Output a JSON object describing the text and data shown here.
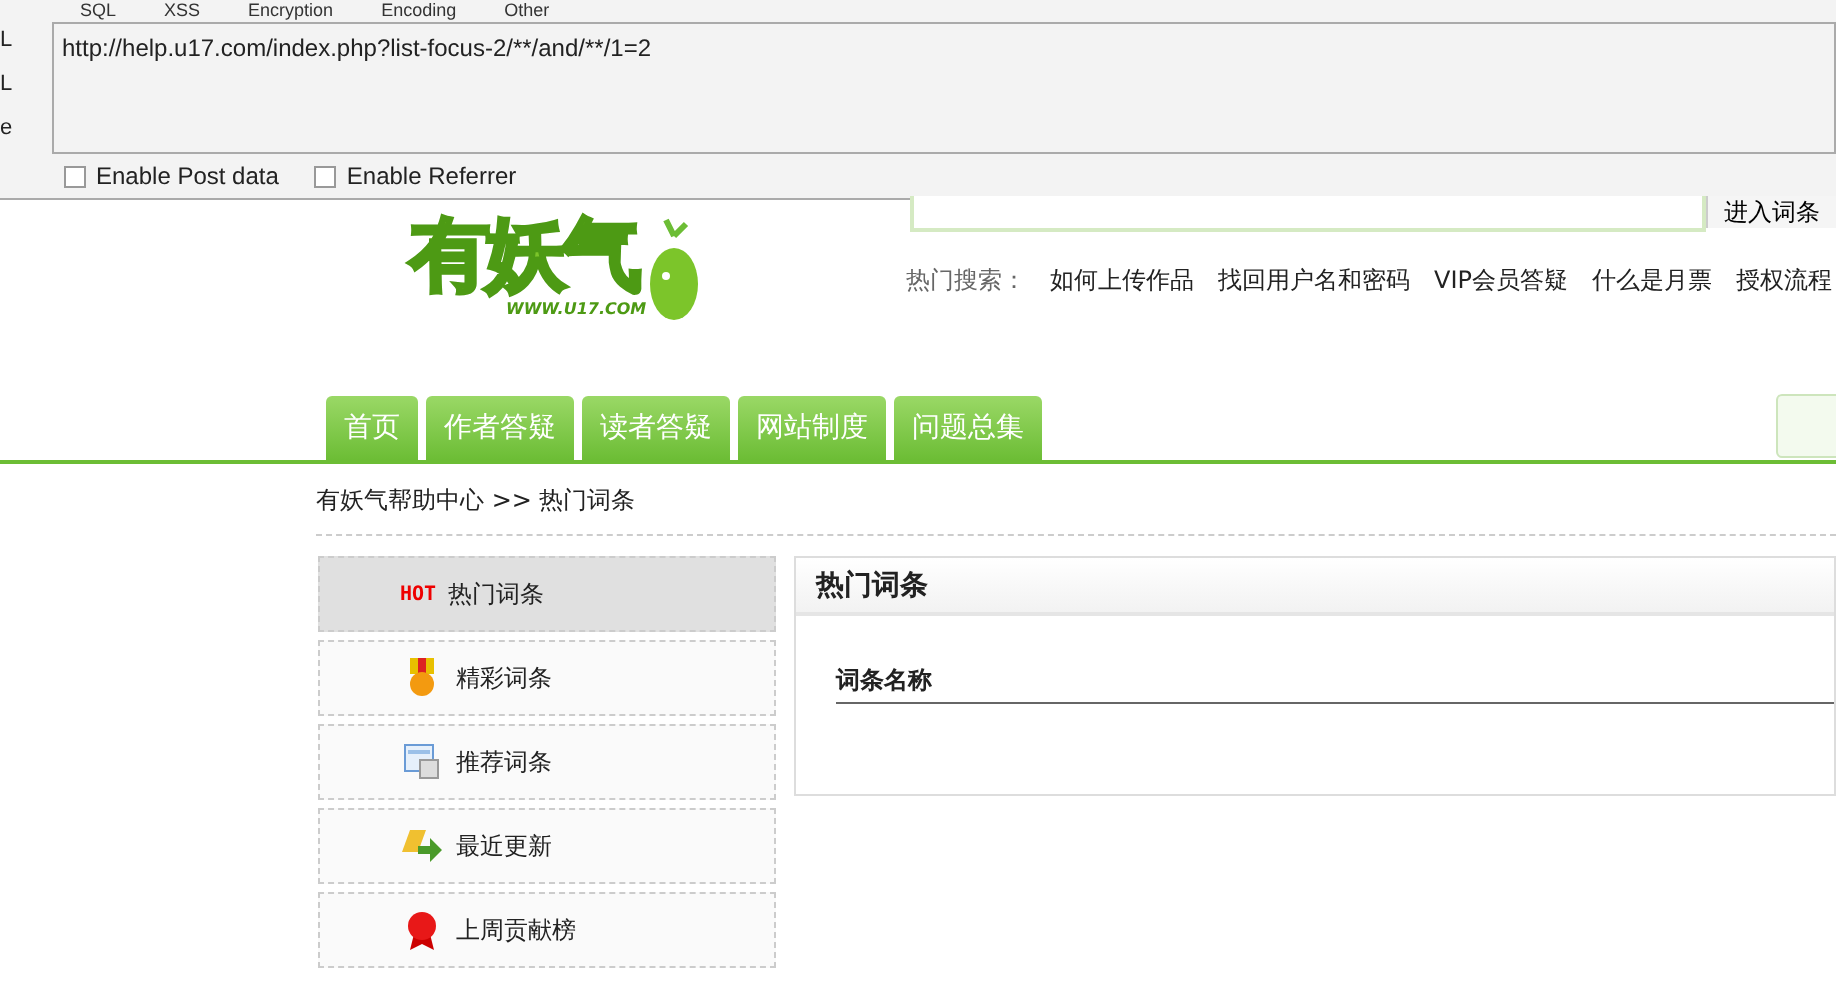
{
  "toolbar": {
    "menu": [
      "SQL",
      "XSS",
      "Encryption",
      "Encoding",
      "Other"
    ],
    "side_labels": [
      "L",
      "L",
      "e"
    ],
    "url": "http://help.u17.com/index.php?list-focus-2/**/and/**/1=2",
    "options": [
      {
        "label": "Enable Post data",
        "checked": false
      },
      {
        "label": "Enable Referrer",
        "checked": false
      }
    ]
  },
  "logo": {
    "title": "有妖气",
    "site": "WWW.U17.COM"
  },
  "search": {
    "button": "进入词条"
  },
  "hot_search": {
    "label": "热门搜索：",
    "links": [
      "如何上传作品",
      "找回用户名和密码",
      "VIP会员答疑",
      "什么是月票",
      "授权流程"
    ]
  },
  "nav": [
    {
      "label": "首页"
    },
    {
      "label": "作者答疑"
    },
    {
      "label": "读者答疑"
    },
    {
      "label": "网站制度"
    },
    {
      "label": "问题总集"
    }
  ],
  "breadcrumb": "有妖气帮助中心 >> 热门词条",
  "sidebar": [
    {
      "kind": "hot",
      "badge": "HOT",
      "label": "热门词条",
      "selected": true
    },
    {
      "kind": "medal",
      "label": "精彩词条",
      "selected": false
    },
    {
      "kind": "doc",
      "label": "推荐词条",
      "selected": false
    },
    {
      "kind": "update",
      "label": "最近更新",
      "selected": false
    },
    {
      "kind": "ribbon",
      "label": "上周贡献榜",
      "selected": false
    }
  ],
  "panel": {
    "title": "热门词条",
    "column": "词条名称"
  }
}
